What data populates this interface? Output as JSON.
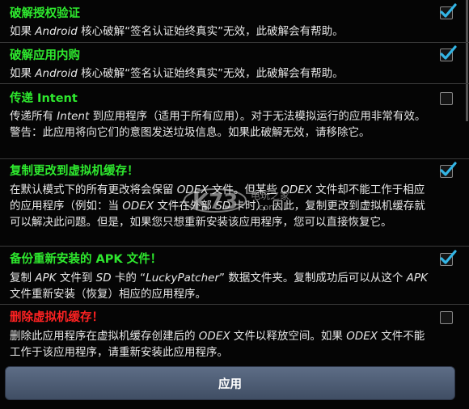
{
  "colors": {
    "title_green": "#2ee82e",
    "title_red": "#ff2222",
    "check_blue": "#33b5e5"
  },
  "options": [
    {
      "title": "破解授权验证",
      "desc": [
        {
          "t": "如果 "
        },
        {
          "t": "Android",
          "i": true
        },
        {
          "t": " 核心破解“签名认证始终真实”无效，此破解会有帮助。"
        }
      ],
      "checked": true
    },
    {
      "title": "破解应用内购",
      "desc": [
        {
          "t": "如果 "
        },
        {
          "t": "Android",
          "i": true
        },
        {
          "t": " 核心破解“签名认证始终真实”无效，此破解会有帮助。"
        }
      ],
      "checked": true
    },
    {
      "title": "传递 Intent",
      "desc": [
        {
          "t": "传递所有 "
        },
        {
          "t": "Intent",
          "i": true
        },
        {
          "t": " 到应用程序（适用于所有应用）。对于无法模拟运行的应用非常有效。警告：此应用将向它们的意图发送垃圾信息。如果此破解无效，请移除它。"
        }
      ],
      "checked": false
    },
    {
      "title": "复制更改到虚拟机缓存！",
      "desc": [
        {
          "t": "在默认模式下的所有更改将会保留 "
        },
        {
          "t": "ODEX",
          "i": true
        },
        {
          "t": " 文件。但某些 "
        },
        {
          "t": "ODEX",
          "i": true
        },
        {
          "t": " 文件却不能工作于相应的应用程序（例如：当 "
        },
        {
          "t": "ODEX",
          "i": true
        },
        {
          "t": " 文件在外部 "
        },
        {
          "t": "SD",
          "i": true
        },
        {
          "t": " 卡时），因此，复制更改到虚拟机缓存就可以解决此问题。但是，如果您只想重新安装该应用程序，您可以直接恢复它。"
        }
      ],
      "checked": true
    },
    {
      "title": "备份重新安装的 APK 文件！",
      "desc": [
        {
          "t": "复制 "
        },
        {
          "t": "APK",
          "i": true
        },
        {
          "t": " 文件到 "
        },
        {
          "t": "SD",
          "i": true
        },
        {
          "t": " 卡的 “"
        },
        {
          "t": "LuckyPatcher",
          "i": true
        },
        {
          "t": "” 数据文件夹。复制成功后可以从这个 "
        },
        {
          "t": "APK",
          "i": true
        },
        {
          "t": " 文件重新安装（恢复）相应的应用程序。"
        }
      ],
      "checked": true
    },
    {
      "title": "删除虚拟机缓存！",
      "desc": [
        {
          "t": "删除此应用程序在虚拟机缓存创建后的 "
        },
        {
          "t": "ODEX",
          "i": true
        },
        {
          "t": " 文件以释放空间。如果 "
        },
        {
          "t": "ODEX",
          "i": true
        },
        {
          "t": " 文件不能工作于该应用程序，请重新安装此应用程序。"
        }
      ],
      "checked": false
    }
  ],
  "apply_label": "应用",
  "watermark": {
    "logo": "K73",
    "line1": "电玩之家",
    "line2": ".com"
  }
}
